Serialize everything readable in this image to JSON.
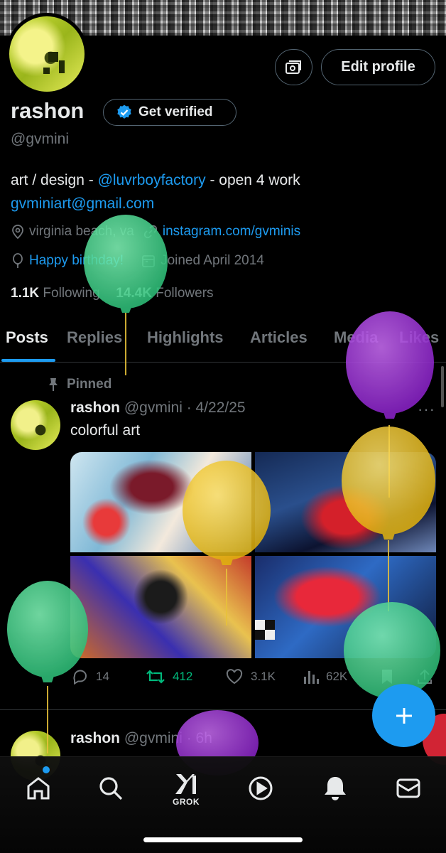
{
  "profile": {
    "name": "rashon",
    "verify_label": "Get verified",
    "handle": "@gvmini",
    "bio_prefix": "art / design - ",
    "bio_mention": "@luvrboyfactory",
    "bio_suffix": " - open 4 work",
    "email": "gvminiart@gmail.com",
    "location": "virginia beach, va",
    "website": "instagram.com/gvminis",
    "birthday": "Happy birthday!",
    "joined": "Joined April 2014",
    "following_count": "1.1K",
    "following_label": "Following",
    "followers_count": "14.4K",
    "followers_label": "Followers",
    "edit_label": "Edit profile"
  },
  "tabs": [
    {
      "label": "Posts"
    },
    {
      "label": "Replies"
    },
    {
      "label": "Highlights"
    },
    {
      "label": "Articles"
    },
    {
      "label": "Media"
    },
    {
      "label": "Likes"
    }
  ],
  "posts": [
    {
      "pinned_label": "Pinned",
      "author": "rashon",
      "meta": "@gvmini · 4/22/25",
      "text": "colorful art",
      "replies": "14",
      "reposts": "412",
      "likes": "3.1K",
      "views": "62K"
    },
    {
      "author": "rashon",
      "meta": "@gvmini · 6h"
    }
  ],
  "nav": {
    "grok_label": "GROK"
  },
  "colors": {
    "accent": "#1d9bf0",
    "repost": "#00ba7c",
    "muted": "#71767b",
    "balloon_green": "#3ed08a",
    "balloon_purple": "#9b2fd6",
    "balloon_yellow": "#f1c21b"
  }
}
